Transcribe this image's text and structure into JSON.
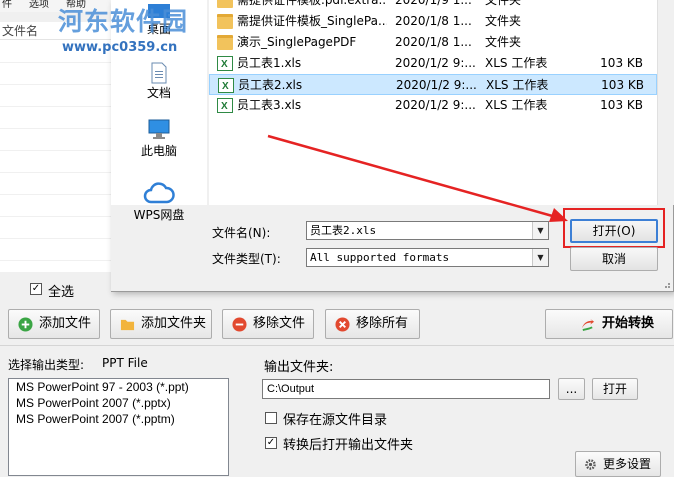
{
  "menubar": {
    "items": [
      "件",
      "选项",
      "帮助"
    ]
  },
  "watermark": {
    "name": "河东软件园",
    "url": "www.pc0359.cn"
  },
  "file_list": {
    "column_header": "文件名"
  },
  "select_all": {
    "label": "全选",
    "checked": true
  },
  "toolbar": {
    "add_file": "添加文件",
    "add_folder": "添加文件夹",
    "remove_file": "移除文件",
    "remove_all": "移除所有",
    "start_convert": "开始转换"
  },
  "output": {
    "type_label": "选择输出类型:",
    "type_value": "PPT File",
    "formats": [
      "MS PowerPoint 97 - 2003 (*.ppt)",
      "MS PowerPoint 2007 (*.pptx)",
      "MS PowerPoint 2007 (*.pptm)"
    ],
    "folder_label": "输出文件夹:",
    "folder_value": "C:\\Output",
    "browse_label": "...",
    "open_label": "打开",
    "save_in_source_label": "保存在源文件目录",
    "save_in_source_checked": false,
    "open_after_label": "转换后打开输出文件夹",
    "open_after_checked": true,
    "more_settings": "更多设置"
  },
  "dialog": {
    "nav": [
      {
        "label": "桌面",
        "icon": "desktop-icon"
      },
      {
        "label": "文档",
        "icon": "document-icon"
      },
      {
        "label": "此电脑",
        "icon": "computer-icon"
      },
      {
        "label": "WPS网盘",
        "icon": "cloud-icon"
      }
    ],
    "files": [
      {
        "name": "需提供证件模板.pdf.extra...",
        "date": "2020/1/9 1...",
        "type": "文件夹",
        "size": "",
        "kind": "folder",
        "selected": false
      },
      {
        "name": "需提供证件模板_SinglePa...",
        "date": "2020/1/8 1...",
        "type": "文件夹",
        "size": "",
        "kind": "folder",
        "selected": false
      },
      {
        "name": "演示_SinglePagePDF",
        "date": "2020/1/8 1...",
        "type": "文件夹",
        "size": "",
        "kind": "folder",
        "selected": false
      },
      {
        "name": "员工表1.xls",
        "date": "2020/1/2 9:...",
        "type": "XLS 工作表",
        "size": "103 KB",
        "kind": "xls",
        "selected": false
      },
      {
        "name": "员工表2.xls",
        "date": "2020/1/2 9:...",
        "type": "XLS 工作表",
        "size": "103 KB",
        "kind": "xls",
        "selected": true
      },
      {
        "name": "员工表3.xls",
        "date": "2020/1/2 9:...",
        "type": "XLS 工作表",
        "size": "103 KB",
        "kind": "xls",
        "selected": false
      }
    ],
    "filename_label": "文件名(N):",
    "filename_value": "员工表2.xls",
    "filetype_label": "文件类型(T):",
    "filetype_value": "All supported formats",
    "open_button": "打开(O)",
    "cancel_button": "取消"
  },
  "annotation": {
    "arrow_color": "#e52323"
  }
}
